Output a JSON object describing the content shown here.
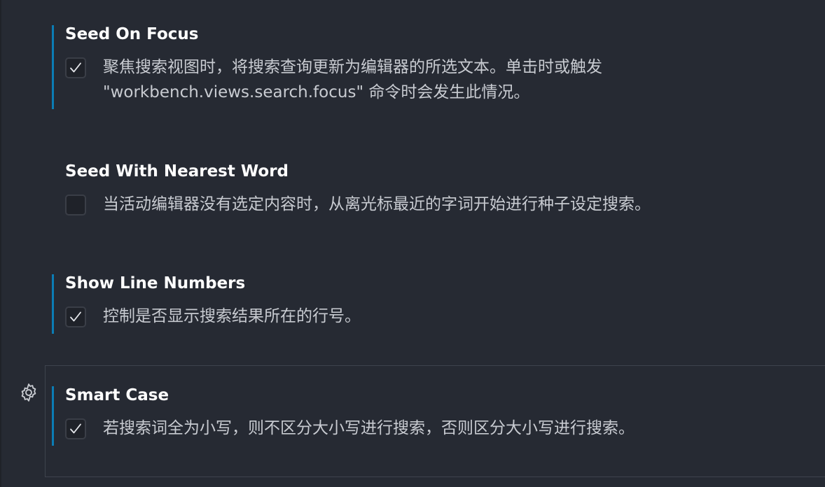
{
  "settings": [
    {
      "title": "Seed On Focus",
      "checked": true,
      "modified": true,
      "description_lines": [
        "聚焦搜索视图时，将搜索查询更新为编辑器的所选文本。单击时或触发",
        "\"workbench.views.search.focus\" 命令时会发生此情况。"
      ]
    },
    {
      "title": "Seed With Nearest Word",
      "checked": false,
      "modified": false,
      "description_lines": [
        "当活动编辑器没有选定内容时，从离光标最近的字词开始进行种子设定搜索。"
      ]
    },
    {
      "title": "Show Line Numbers",
      "checked": true,
      "modified": true,
      "description_lines": [
        "控制是否显示搜索结果所在的行号。"
      ]
    },
    {
      "title": "Smart Case",
      "checked": true,
      "modified": true,
      "focused": true,
      "description_lines": [
        "若搜索词全为小写，则不区分大小写进行搜索，否则区分大小写进行搜索。"
      ]
    }
  ],
  "icons": {
    "gear": "gear-icon",
    "check": "check-icon"
  },
  "colors": {
    "background": "#262a33",
    "modified_indicator": "#0b7db5",
    "title": "#ffffff",
    "description": "#c8cbd1",
    "checkbox_border": "#3a3e47",
    "checkbox_fill": "#1f2229",
    "focus_outline": "#3e434d"
  }
}
